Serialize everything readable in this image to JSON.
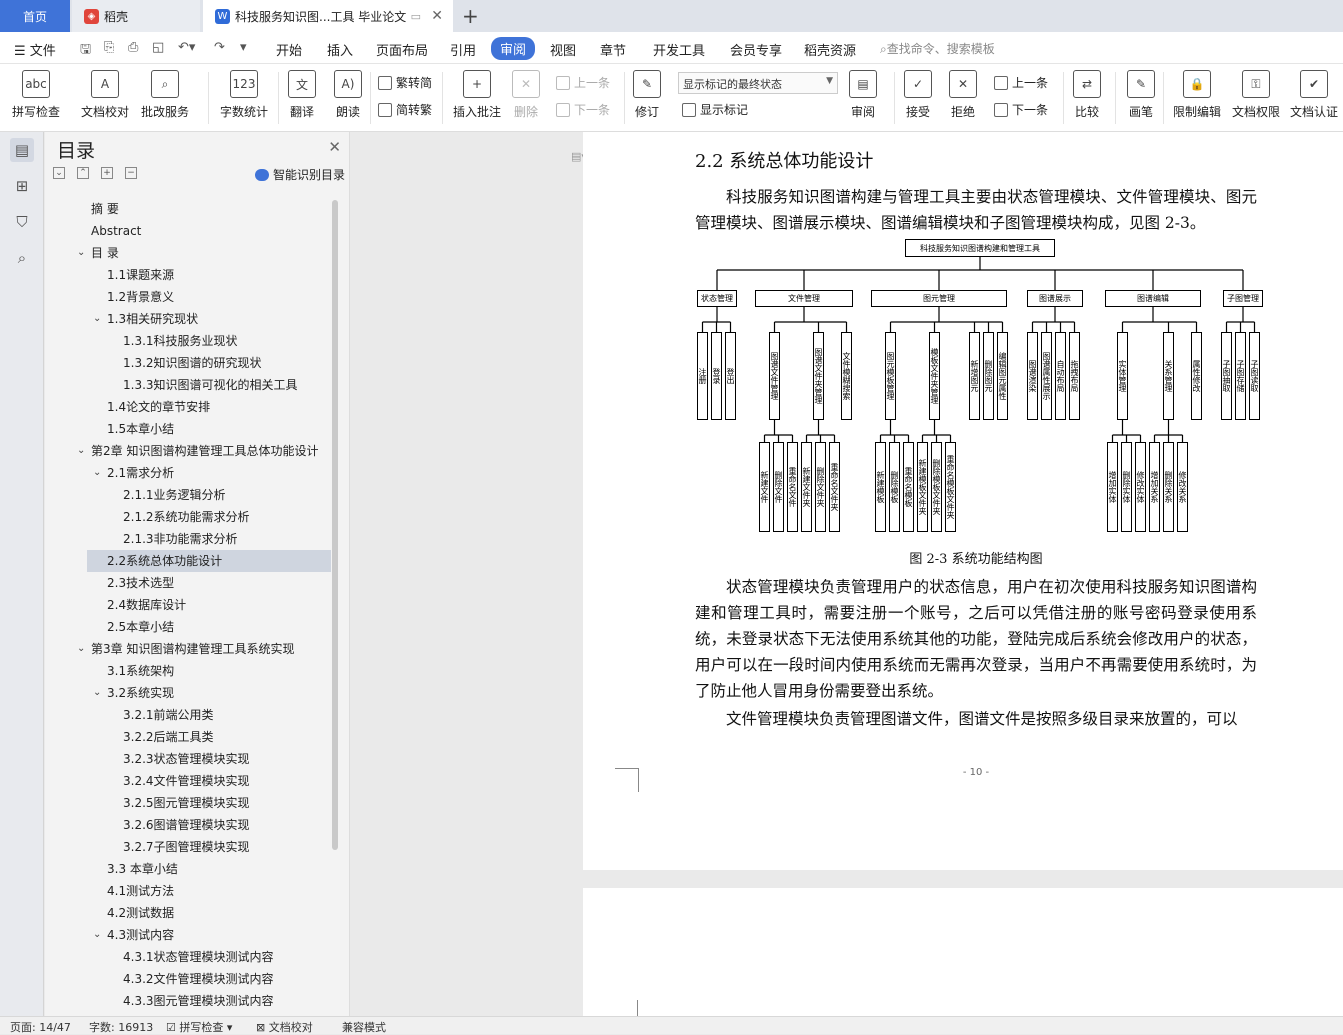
{
  "tabs": {
    "home": "首页",
    "daoke": "稻壳",
    "doc": "科技服务知识图...工具 毕业论文"
  },
  "menu": {
    "file": "文件",
    "items": [
      "开始",
      "插入",
      "页面布局",
      "引用",
      "审阅",
      "视图",
      "章节",
      "开发工具",
      "会员专享",
      "稻壳资源"
    ],
    "search": "查找命令、搜索模板"
  },
  "ribbon": {
    "spell": "拼写检查",
    "proof": "文档校对",
    "annotate": "批改服务",
    "wordcount": "字数统计",
    "translate": "翻译",
    "read": "朗读",
    "to_trad": "繁转简",
    "to_simp": "简转繁",
    "insert_comment": "插入批注",
    "delete": "删除",
    "prev_comment": "上一条",
    "next_comment": "下一条",
    "revise": "修订",
    "markup_state": "显示标记的最终状态",
    "show_markup": "显示标记",
    "review": "审阅",
    "accept": "接受",
    "reject": "拒绝",
    "prev_change": "上一条",
    "next_change": "下一条",
    "compare": "比较",
    "pen": "画笔",
    "restrict": "限制编辑",
    "permission": "文档权限",
    "certify": "文档认证"
  },
  "toc": {
    "title": "目录",
    "smart": "智能识别目录",
    "items": [
      {
        "label": "摘  要",
        "level": 1,
        "arrow": ""
      },
      {
        "label": "Abstract",
        "level": 1,
        "arrow": ""
      },
      {
        "label": "目  录",
        "level": 1,
        "arrow": "v"
      },
      {
        "label": "1.1课题来源",
        "level": 2,
        "arrow": ""
      },
      {
        "label": "1.2背景意义",
        "level": 2,
        "arrow": ""
      },
      {
        "label": "1.3相关研究现状",
        "level": 2,
        "arrow": "v"
      },
      {
        "label": "1.3.1科技服务业现状",
        "level": 3,
        "arrow": ""
      },
      {
        "label": "1.3.2知识图谱的研究现状",
        "level": 3,
        "arrow": ""
      },
      {
        "label": "1.3.3知识图谱可视化的相关工具",
        "level": 3,
        "arrow": ""
      },
      {
        "label": "1.4论文的章节安排",
        "level": 2,
        "arrow": ""
      },
      {
        "label": "1.5本章小结",
        "level": 2,
        "arrow": ""
      },
      {
        "label": "第2章 知识图谱构建管理工具总体功能设计",
        "level": 1,
        "arrow": "v"
      },
      {
        "label": "2.1需求分析",
        "level": 2,
        "arrow": "v"
      },
      {
        "label": "2.1.1业务逻辑分析",
        "level": 3,
        "arrow": ""
      },
      {
        "label": "2.1.2系统功能需求分析",
        "level": 3,
        "arrow": ""
      },
      {
        "label": "2.1.3非功能需求分析",
        "level": 3,
        "arrow": ""
      },
      {
        "label": "2.2系统总体功能设计",
        "level": 2,
        "arrow": "",
        "selected": true
      },
      {
        "label": "2.3技术选型",
        "level": 2,
        "arrow": ""
      },
      {
        "label": "2.4数据库设计",
        "level": 2,
        "arrow": ""
      },
      {
        "label": "2.5本章小结",
        "level": 2,
        "arrow": ""
      },
      {
        "label": "第3章 知识图谱构建管理工具系统实现",
        "level": 1,
        "arrow": "v"
      },
      {
        "label": "3.1系统架构",
        "level": 2,
        "arrow": ""
      },
      {
        "label": "3.2系统实现",
        "level": 2,
        "arrow": "v"
      },
      {
        "label": "3.2.1前端公用类",
        "level": 3,
        "arrow": ""
      },
      {
        "label": "3.2.2后端工具类",
        "level": 3,
        "arrow": ""
      },
      {
        "label": "3.2.3状态管理模块实现",
        "level": 3,
        "arrow": ""
      },
      {
        "label": "3.2.4文件管理模块实现",
        "level": 3,
        "arrow": ""
      },
      {
        "label": "3.2.5图元管理模块实现",
        "level": 3,
        "arrow": ""
      },
      {
        "label": "3.2.6图谱管理模块实现",
        "level": 3,
        "arrow": ""
      },
      {
        "label": "3.2.7子图管理模块实现",
        "level": 3,
        "arrow": ""
      },
      {
        "label": "3.3 本章小结",
        "level": 2,
        "arrow": ""
      },
      {
        "label": "4.1测试方法",
        "level": 2,
        "arrow": ""
      },
      {
        "label": "4.2测试数据",
        "level": 2,
        "arrow": ""
      },
      {
        "label": "4.3测试内容",
        "level": 2,
        "arrow": "v"
      },
      {
        "label": "4.3.1状态管理模块测试内容",
        "level": 3,
        "arrow": ""
      },
      {
        "label": "4.3.2文件管理模块测试内容",
        "level": 3,
        "arrow": ""
      },
      {
        "label": "4.3.3图元管理模块测试内容",
        "level": 3,
        "arrow": ""
      }
    ]
  },
  "doc": {
    "heading": "2.2  系统总体功能设计",
    "para1": "科技服务知识图谱构建与管理工具主要由状态管理模块、文件管理模块、图元管理模块、图谱展示模块、图谱编辑模块和子图管理模块构成，见图 2-3。",
    "caption": "图 2-3 系统功能结构图",
    "para2": "状态管理模块负责管理用户的状态信息，用户在初次使用科技服务知识图谱构建和管理工具时，需要注册一个账号，之后可以凭借注册的账号密码登录使用系统，未登录状态下无法使用系统其他的功能，登陆完成后系统会修改用户的状态，用户可以在一段时间内使用系统而无需再次登录，当用户不再需要使用系统时，为了防止他人冒用身份需要登出系统。",
    "para3": "文件管理模块负责管理图谱文件，图谱文件是按照多级目录来放置的，可以",
    "page_number": "- 10 -"
  },
  "diagram": {
    "root": "科技服务知识图谱构建和管理工具",
    "modules": [
      "状态管理",
      "文件管理",
      "图元管理",
      "图谱展示",
      "图谱编辑",
      "子图管理"
    ],
    "state_leaves": [
      "注册",
      "登录",
      "登出"
    ],
    "file_subs": [
      "图谱文件管理",
      "图谱文件夹管理",
      "文件模糊搜索"
    ],
    "file_leaves_a": [
      "新建文件",
      "删除文件",
      "重命名文件"
    ],
    "file_leaves_b": [
      "新建文件夹",
      "删除文件夹",
      "重命名文件夹"
    ],
    "elem_subs": [
      "图元模板管理",
      "模板文件夹管理",
      "新增图元",
      "删除图元",
      "编辑图元属性"
    ],
    "elem_leaves_a": [
      "新建模板",
      "删除模板",
      "重命名模板"
    ],
    "elem_leaves_b": [
      "新建模板文件夹",
      "删除模板文件夹",
      "重命名模板文件夹"
    ],
    "show_leaves": [
      "图谱渲染",
      "图谱属性展示",
      "自动布局",
      "拖拽布局"
    ],
    "edit_subs": [
      "实体管理",
      "关系管理",
      "属性修改"
    ],
    "edit_leaves_a": [
      "增加实体",
      "删除实体",
      "修改实体"
    ],
    "edit_leaves_b": [
      "增加关系",
      "删除关系",
      "修改关系"
    ],
    "sub_leaves": [
      "子图抽取",
      "子图存储",
      "子图读取"
    ]
  },
  "status": {
    "page": "页面: 14/47",
    "words": "字数: 16913",
    "spell": "拼写检查",
    "proof": "文档校对",
    "compat": "兼容模式"
  }
}
